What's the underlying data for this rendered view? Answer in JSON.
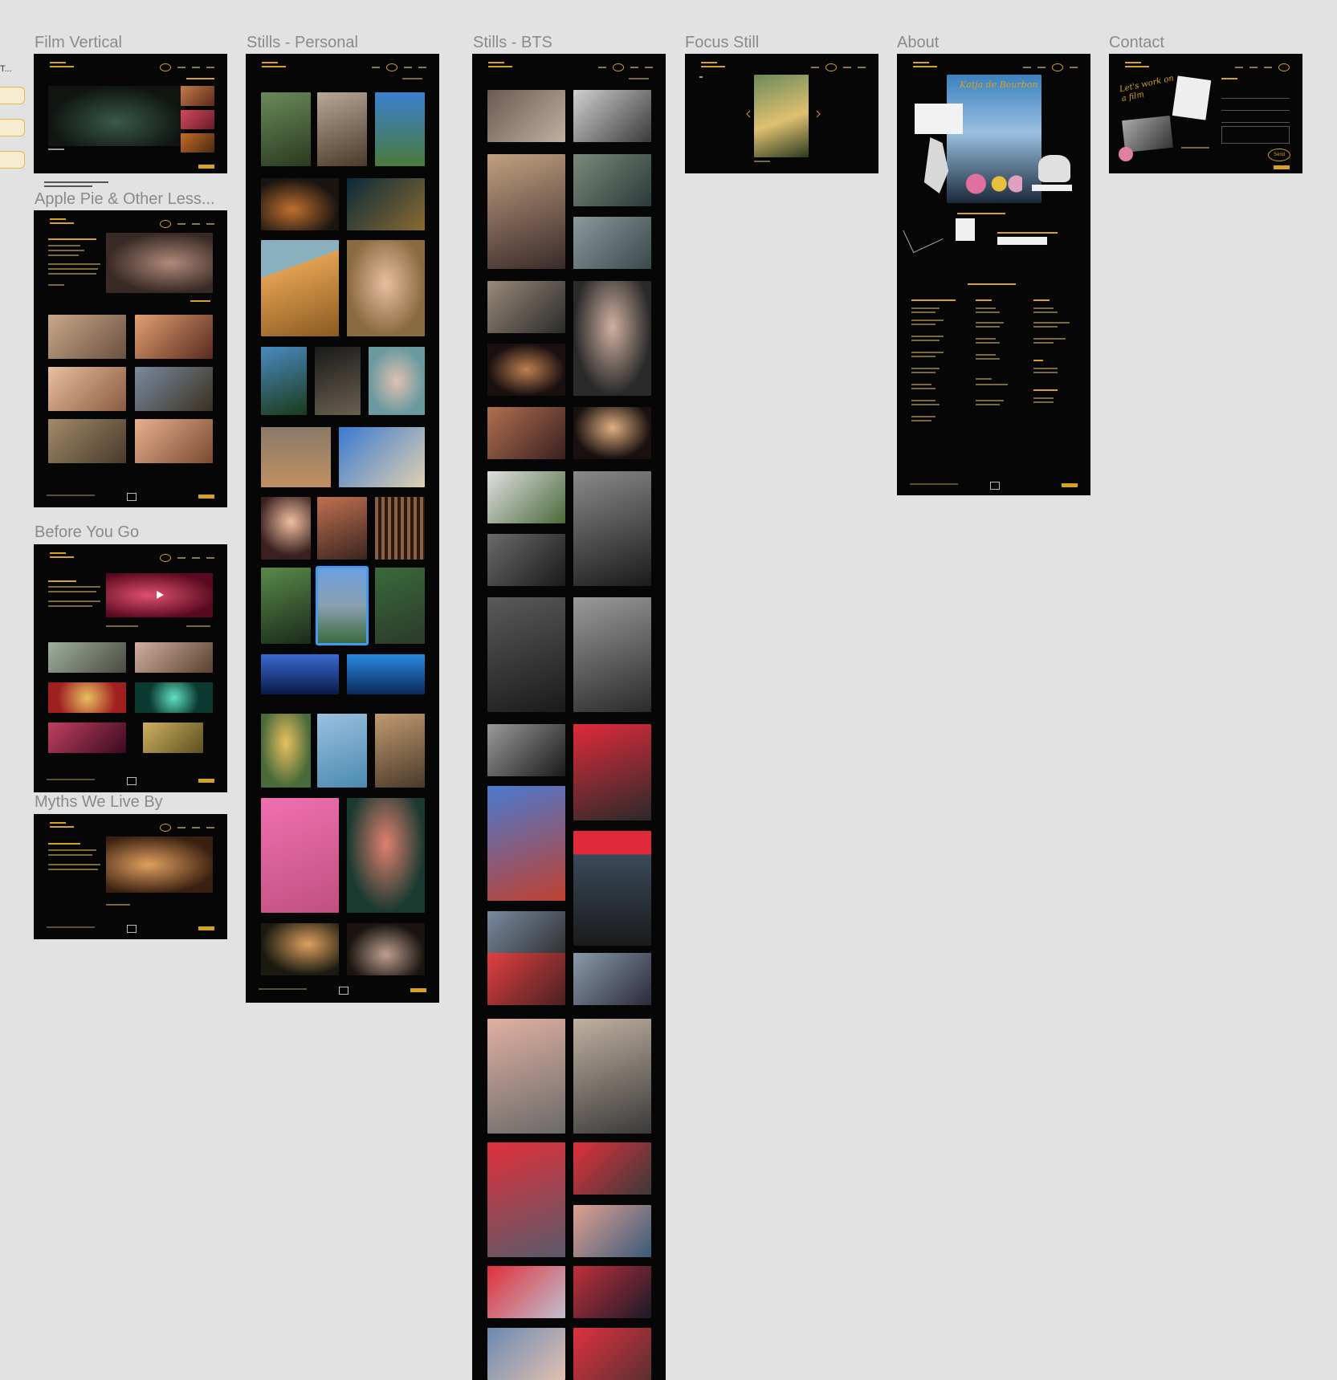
{
  "canvas": {
    "background": "#e2e2e2",
    "accent": "#d5a321",
    "selection": "#3d9df2",
    "sidebar_truncated": "T...",
    "note_lines": [
      "",
      ""
    ]
  },
  "frames": [
    {
      "id": "film-vertical",
      "label": "Film Vertical"
    },
    {
      "id": "apple-pie",
      "label": "Apple Pie & Other Less..."
    },
    {
      "id": "before-you-go",
      "label": "Before You Go"
    },
    {
      "id": "myths",
      "label": "Myths We Live By"
    },
    {
      "id": "stills-personal",
      "label": "Stills - Personal"
    },
    {
      "id": "stills-bts",
      "label": "Stills - BTS"
    },
    {
      "id": "focus-still",
      "label": "Focus Still"
    },
    {
      "id": "about",
      "label": "About"
    },
    {
      "id": "contact",
      "label": "Contact"
    }
  ],
  "about_page": {
    "script_title": "Katja de Bourbon"
  },
  "contact_page": {
    "handwritten": "Let's work on a film",
    "button": "Send"
  },
  "icons": [
    "play-icon",
    "camera-logo-icon",
    "chevron-left-icon",
    "chevron-right-icon"
  ]
}
